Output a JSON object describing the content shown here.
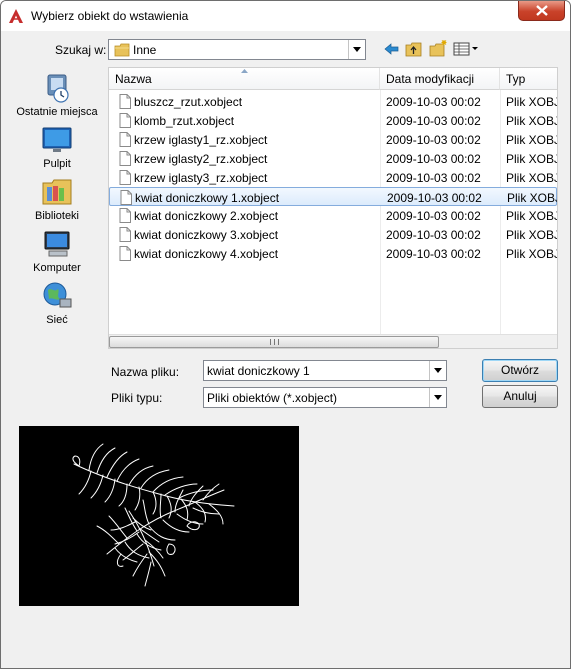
{
  "window": {
    "title": "Wybierz obiekt do wstawienia"
  },
  "lookin": {
    "label": "Szukaj w:",
    "value": "Inne"
  },
  "places": [
    {
      "label": "Ostatnie miejsca",
      "icon": "recent-places-icon"
    },
    {
      "label": "Pulpit",
      "icon": "desktop-icon"
    },
    {
      "label": "Biblioteki",
      "icon": "libraries-icon"
    },
    {
      "label": "Komputer",
      "icon": "computer-icon"
    },
    {
      "label": "Sieć",
      "icon": "network-icon"
    }
  ],
  "list": {
    "columns": [
      "Nazwa",
      "Data modyfikacji",
      "Typ"
    ],
    "rows": [
      {
        "name": "bluszcz_rzut.xobject",
        "date": "2009-10-03 00:02",
        "type": "Plik XOBJECT"
      },
      {
        "name": "klomb_rzut.xobject",
        "date": "2009-10-03 00:02",
        "type": "Plik XOBJECT"
      },
      {
        "name": "krzew iglasty1_rz.xobject",
        "date": "2009-10-03 00:02",
        "type": "Plik XOBJECT"
      },
      {
        "name": "krzew iglasty2_rz.xobject",
        "date": "2009-10-03 00:02",
        "type": "Plik XOBJECT"
      },
      {
        "name": "krzew iglasty3_rz.xobject",
        "date": "2009-10-03 00:02",
        "type": "Plik XOBJECT"
      },
      {
        "name": "kwiat doniczkowy 1.xobject",
        "date": "2009-10-03 00:02",
        "type": "Plik XOBJECT"
      },
      {
        "name": "kwiat doniczkowy 2.xobject",
        "date": "2009-10-03 00:02",
        "type": "Plik XOBJECT"
      },
      {
        "name": "kwiat doniczkowy 3.xobject",
        "date": "2009-10-03 00:02",
        "type": "Plik XOBJECT"
      },
      {
        "name": "kwiat doniczkowy 4.xobject",
        "date": "2009-10-03 00:02",
        "type": "Plik XOBJECT"
      }
    ],
    "selected_index": 5
  },
  "filename": {
    "label": "Nazwa pliku:",
    "value": "kwiat doniczkowy 1"
  },
  "filetype": {
    "label": "Pliki typu:",
    "value": "Pliki obiektów (*.xobject)"
  },
  "buttons": {
    "open": "Otwórz",
    "cancel": "Anuluj"
  },
  "colors": {
    "accent": "#84acdd",
    "preview_bg": "#000000",
    "close_button": "#c9422a"
  }
}
